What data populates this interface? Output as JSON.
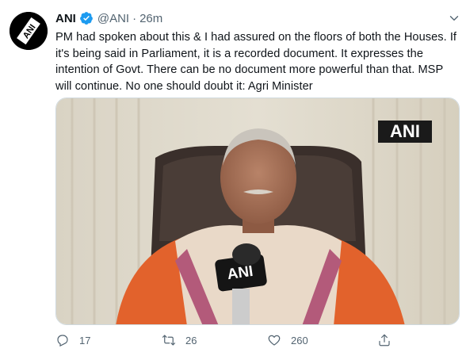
{
  "tweet": {
    "author_name": "ANI",
    "handle": "@ANI",
    "separator": "·",
    "time": "26m",
    "text": "PM had spoken about this & I had assured on the floors of both the Houses. If it's being said in Parliament, it is a recorded document. It expresses the intention of Govt. There can be no document more powerful than that. MSP will continue. No one should doubt it: Agri Minister",
    "media_watermark": "ANI",
    "mic_label": "ANI"
  },
  "actions": {
    "replies": "17",
    "retweets": "26",
    "likes": "260"
  },
  "colors": {
    "verified": "#1d9bf0",
    "text": "#0f1419",
    "muted": "#536471"
  }
}
